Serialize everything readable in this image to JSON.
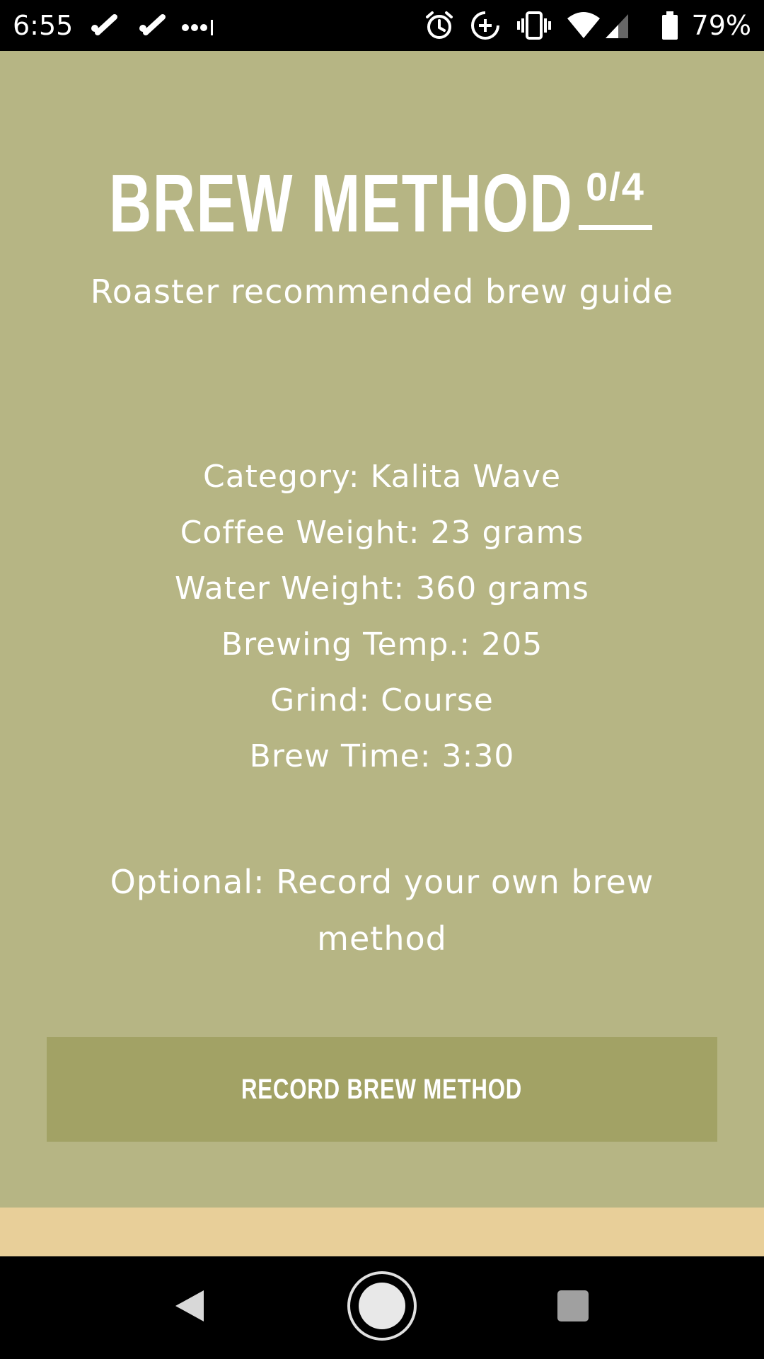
{
  "status_bar": {
    "time": "6:55",
    "battery_percent": "79%",
    "left_icons": [
      "check-notification-icon",
      "check-notification-icon",
      "more-notifications-icon"
    ],
    "right_icons": [
      "alarm-icon",
      "data-saver-icon",
      "vibrate-icon",
      "wifi-icon",
      "cell-signal-icon",
      "battery-icon"
    ]
  },
  "header": {
    "title": "BREW METHOD",
    "step_counter": "0/4",
    "subtitle": "Roaster recommended brew guide"
  },
  "details": [
    "Category: Kalita Wave",
    "Coffee Weight: 23 grams",
    "Water Weight: 360 grams",
    "Brewing Temp.: 205",
    "Grind: Course",
    "Brew Time: 3:30"
  ],
  "optional_note": "Optional: Record your own brew method",
  "record_button": {
    "label": "RECORD BREW METHOD"
  },
  "nav_bar": {
    "icons": [
      "back-icon",
      "home-icon",
      "recents-icon"
    ]
  },
  "colors": {
    "panel_background": "#b6b584",
    "button_background": "#a2a265",
    "footer_strip": "#e8cf99",
    "text": "#ffffff"
  }
}
